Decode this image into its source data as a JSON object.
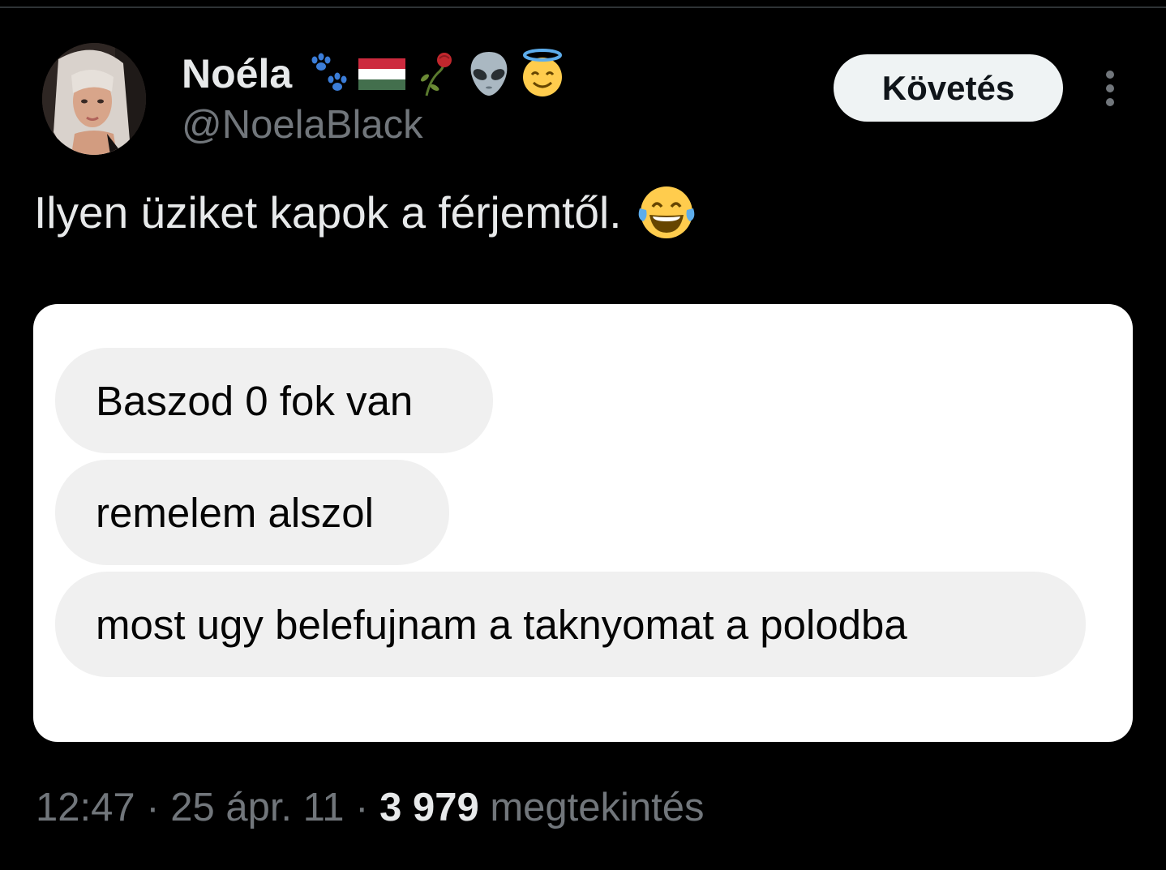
{
  "author": {
    "display_name": "Noéla",
    "handle": "@NoelaBlack",
    "name_emojis": [
      "paw-prints",
      "hungary-flag",
      "wilted-rose",
      "alien",
      "smiling-face-with-halo"
    ]
  },
  "follow_label": "Követés",
  "tweet": {
    "text": "Ilyen üziket kapok a férjemtől.",
    "emoji": "face-with-tears-of-joy"
  },
  "messages": [
    "Baszod 0 fok van",
    "remelem alszol",
    "most ugy belefujnam a taknyomat a polodba"
  ],
  "meta": {
    "time": "12:47",
    "separator": "·",
    "date": "25 ápr. 11",
    "view_count": "3 979",
    "view_label": "megtekintés"
  },
  "colors": {
    "background": "#000000",
    "text_primary": "#e7e9ea",
    "text_secondary": "#71767b",
    "follow_bg": "#eff3f4",
    "bubble_bg": "#f0f0f0"
  }
}
